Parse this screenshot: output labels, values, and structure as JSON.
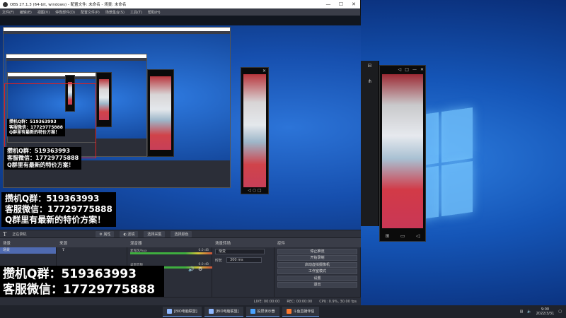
{
  "window": {
    "title": "OBS 27.1.3 (64-bit, windows) - 配置文件: 未命名 - 场景: 未命名",
    "minimize": "—",
    "maximize": "☐",
    "close": "✕"
  },
  "menu": [
    "文件(F)",
    "编辑(E)",
    "视图(V)",
    "停靠部件(D)",
    "配置文件(P)",
    "场景集合(S)",
    "工具(T)",
    "帮助(H)"
  ],
  "promo": {
    "line1": "攒机Q群：519363993",
    "line2": "客服微信：17729775888",
    "line3": "Q群里有最新的特价方案！"
  },
  "toolbar": {
    "source_name": "正在录机",
    "properties": "属性",
    "filters": "滤镜",
    "item3": "选择采集",
    "item4": "选择颜色"
  },
  "docks": {
    "scenes": "场景",
    "sources": "来源",
    "mixer": "混音器",
    "transitions": "场景转场",
    "controls": "控件"
  },
  "scenes": [
    "场景"
  ],
  "mixer": [
    {
      "label": "麦克风/Aux",
      "db": "0.0 dB"
    },
    {
      "label": "桌面音频",
      "db": "0.0 dB"
    }
  ],
  "transitions": {
    "type": "渐变",
    "duration_label": "时长",
    "duration": "300 ms"
  },
  "controls": [
    "停止推流",
    "开始录制",
    "启动虚拟摄像机",
    "工作室模式",
    "设置",
    "退出"
  ],
  "status": {
    "live": "LIVE: 00:00:00",
    "rec": "REC: 00:00:00",
    "cpu": "CPU: 0.9%, 30.00 fps"
  },
  "taskbar": {
    "apps": [
      "[BIO电脑联盟]",
      "[BIO电脑联盟]",
      "投屏演示器",
      "斗鱼直播伴侣"
    ],
    "time": "9:00",
    "date": "2022/3/31"
  },
  "icons": {
    "share": "share-icon",
    "back": "back-icon",
    "home": "home-icon",
    "recent": "recent-apps-icon"
  }
}
